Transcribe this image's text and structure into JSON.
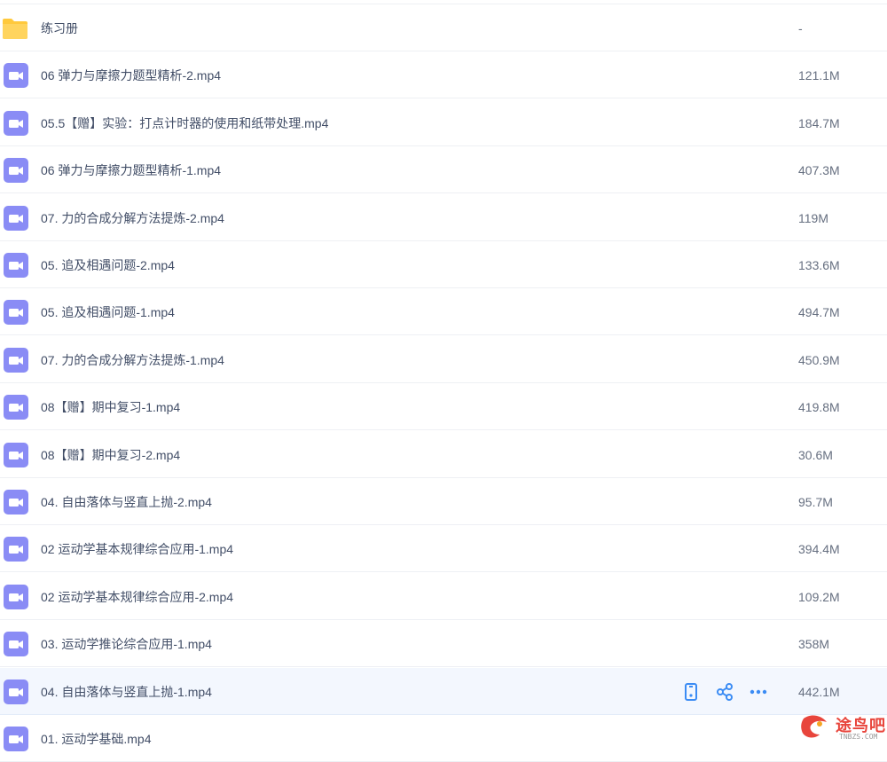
{
  "files": [
    {
      "name": "练习册",
      "size": "-",
      "type": "folder"
    },
    {
      "name": "06 弹力与摩擦力题型精析-2.mp4",
      "size": "121.1M",
      "type": "video"
    },
    {
      "name": "05.5【赠】实验：打点计时器的使用和纸带处理.mp4",
      "size": "184.7M",
      "type": "video"
    },
    {
      "name": "06 弹力与摩擦力题型精析-1.mp4",
      "size": "407.3M",
      "type": "video"
    },
    {
      "name": "07. 力的合成分解方法提炼-2.mp4",
      "size": "119M",
      "type": "video"
    },
    {
      "name": "05. 追及相遇问题-2.mp4",
      "size": "133.6M",
      "type": "video"
    },
    {
      "name": "05. 追及相遇问题-1.mp4",
      "size": "494.7M",
      "type": "video"
    },
    {
      "name": "07. 力的合成分解方法提炼-1.mp4",
      "size": "450.9M",
      "type": "video"
    },
    {
      "name": "08【赠】期中复习-1.mp4",
      "size": "419.8M",
      "type": "video"
    },
    {
      "name": "08【赠】期中复习-2.mp4",
      "size": "30.6M",
      "type": "video"
    },
    {
      "name": "04. 自由落体与竖直上抛-2.mp4",
      "size": "95.7M",
      "type": "video"
    },
    {
      "name": "02 运动学基本规律综合应用-1.mp4",
      "size": "394.4M",
      "type": "video"
    },
    {
      "name": "02 运动学基本规律综合应用-2.mp4",
      "size": "109.2M",
      "type": "video"
    },
    {
      "name": "03. 运动学推论综合应用-1.mp4",
      "size": "358M",
      "type": "video"
    },
    {
      "name": "04. 自由落体与竖直上抛-1.mp4",
      "size": "442.1M",
      "type": "video",
      "hovered": true
    },
    {
      "name": "01. 运动学基础.mp4",
      "size": "",
      "type": "video"
    }
  ],
  "row_actions": [
    "phone-icon",
    "share-icon",
    "more-icon"
  ],
  "colors": {
    "video_icon": "#8a8cf5",
    "folder_icon": "#ffc93d",
    "action_icon": "#3b8cf4",
    "hover_row": "#f3f7fe"
  },
  "watermark": {
    "title": "途鸟吧",
    "sub": "TNBZS.COM"
  }
}
